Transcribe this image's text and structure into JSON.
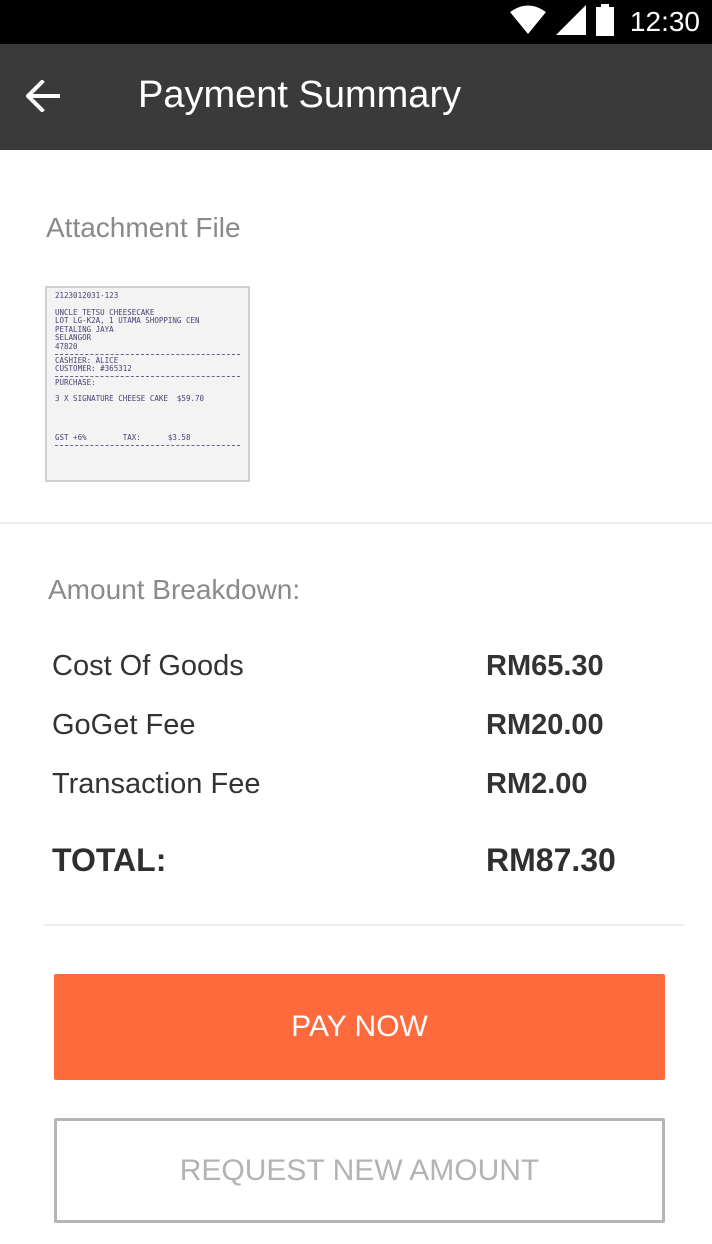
{
  "status_bar": {
    "time": "12:30",
    "icons": [
      "wifi-icon",
      "cellular-signal-icon",
      "battery-icon"
    ]
  },
  "app_bar": {
    "back_icon": "arrow-left-icon",
    "title": "Payment Summary"
  },
  "attachment": {
    "label": "Attachment File",
    "receipt_lines": [
      "2123012031-123",
      "",
      "UNCLE TETSU CHEESECAKE",
      "LOT LG-K2A, 1 UTAMA SHOPPING CEN",
      "PETALING JAYA",
      "SELANGOR",
      "47820",
      "---",
      "CASHIER: ALICE",
      "CUSTOMER: #365312",
      "---",
      "PURCHASE:",
      "",
      "3 X SIGNATURE CHEESE CAKE  $59.70",
      "",
      "GST +6%        TAX:      $3.58"
    ]
  },
  "breakdown": {
    "label": "Amount Breakdown:",
    "items": [
      {
        "label": "Cost Of Goods",
        "value": "RM65.30"
      },
      {
        "label": "GoGet Fee",
        "value": "RM20.00"
      },
      {
        "label": "Transaction Fee",
        "value": "RM2.00"
      }
    ],
    "total_label": "TOTAL:",
    "total_value": "RM87.30"
  },
  "actions": {
    "pay_label": "PAY NOW",
    "request_label": "REQUEST NEW AMOUNT"
  },
  "colors": {
    "accent": "#ff6a3d",
    "app_bar": "#3a3a3a",
    "status_bar": "#000000"
  }
}
